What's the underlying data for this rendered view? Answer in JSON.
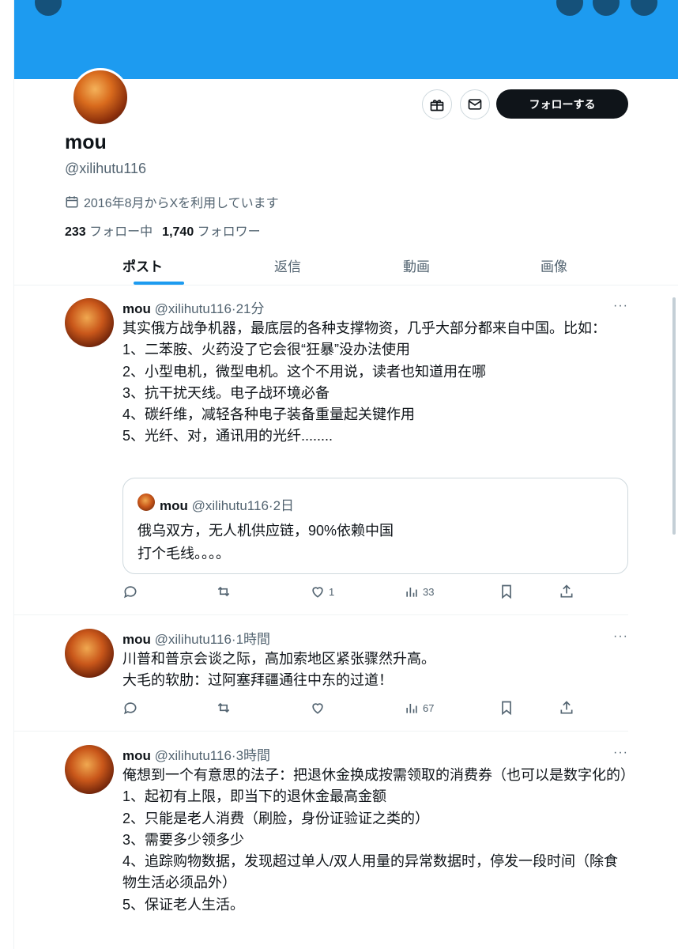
{
  "profile": {
    "name": "mou",
    "handle": "@xilihutu116",
    "joined": "2016年8月からXを利用しています",
    "following_count": "233",
    "following_label": "フォロー中",
    "followers_count": "1,740",
    "followers_label": "フォロワー",
    "follow_label": "フォローする"
  },
  "tabs": [
    "ポスト",
    "返信",
    "動画",
    "画像"
  ],
  "posts": [
    {
      "name": "mou",
      "handle": "@xilihutu116",
      "time": "·21分",
      "lines": [
        "其实俄方战争机器，最底层的各种支撑物资，几乎大部分都来自中国。比如：",
        "1、二苯胺、火药没了它会很“狂暴”没办法使用",
        "2、小型电机，微型电机。这个不用说，读者也知道用在哪",
        "3、抗干扰天线。电子战环境必备",
        "4、碳纤维，减轻各种电子装备重量起关键作用",
        "5、光纤、对，通讯用的光纤........"
      ],
      "quote": {
        "name": "mou",
        "handle": "@xilihutu116",
        "time": "·2日",
        "lines": [
          "俄乌双方，无人机供应链，90%依赖中国",
          "打个毛线。。。。"
        ]
      },
      "likes": "1",
      "views": "33"
    },
    {
      "name": "mou",
      "handle": "@xilihutu116",
      "time": "·1時間",
      "lines": [
        "川普和普京会谈之际，高加索地区紧张骤然升高。",
        "大毛的软肋：过阿塞拜疆通往中东的过道！"
      ],
      "views": "67"
    },
    {
      "name": "mou",
      "handle": "@xilihutu116",
      "time": "·3時間",
      "lines": [
        "俺想到一个有意思的法子：把退休金换成按需领取的消费券（也可以是数字化的）",
        "1、起初有上限，即当下的退休金最高金额",
        "2、只能是老人消费（刷脸，身份证验证之类的）",
        "3、需要多少领多少",
        "4、追踪购物数据，发现超过单人/双人用量的异常数据时，停发一段时间（除食物生活必须品外）",
        "5、保证老人生活。"
      ]
    }
  ],
  "icons": {
    "calendar": "calendar-icon",
    "gift": "gift-icon",
    "mail": "mail-icon",
    "more": "more-icon",
    "reply": "reply-icon",
    "repost": "repost-icon",
    "like": "like-icon",
    "views": "views-icon",
    "bookmark": "bookmark-icon",
    "share": "share-icon"
  },
  "colors": {
    "banner": "#1d9bf0",
    "accent": "#1d9bf0",
    "text": "#0f1419",
    "secondary": "#536471"
  }
}
